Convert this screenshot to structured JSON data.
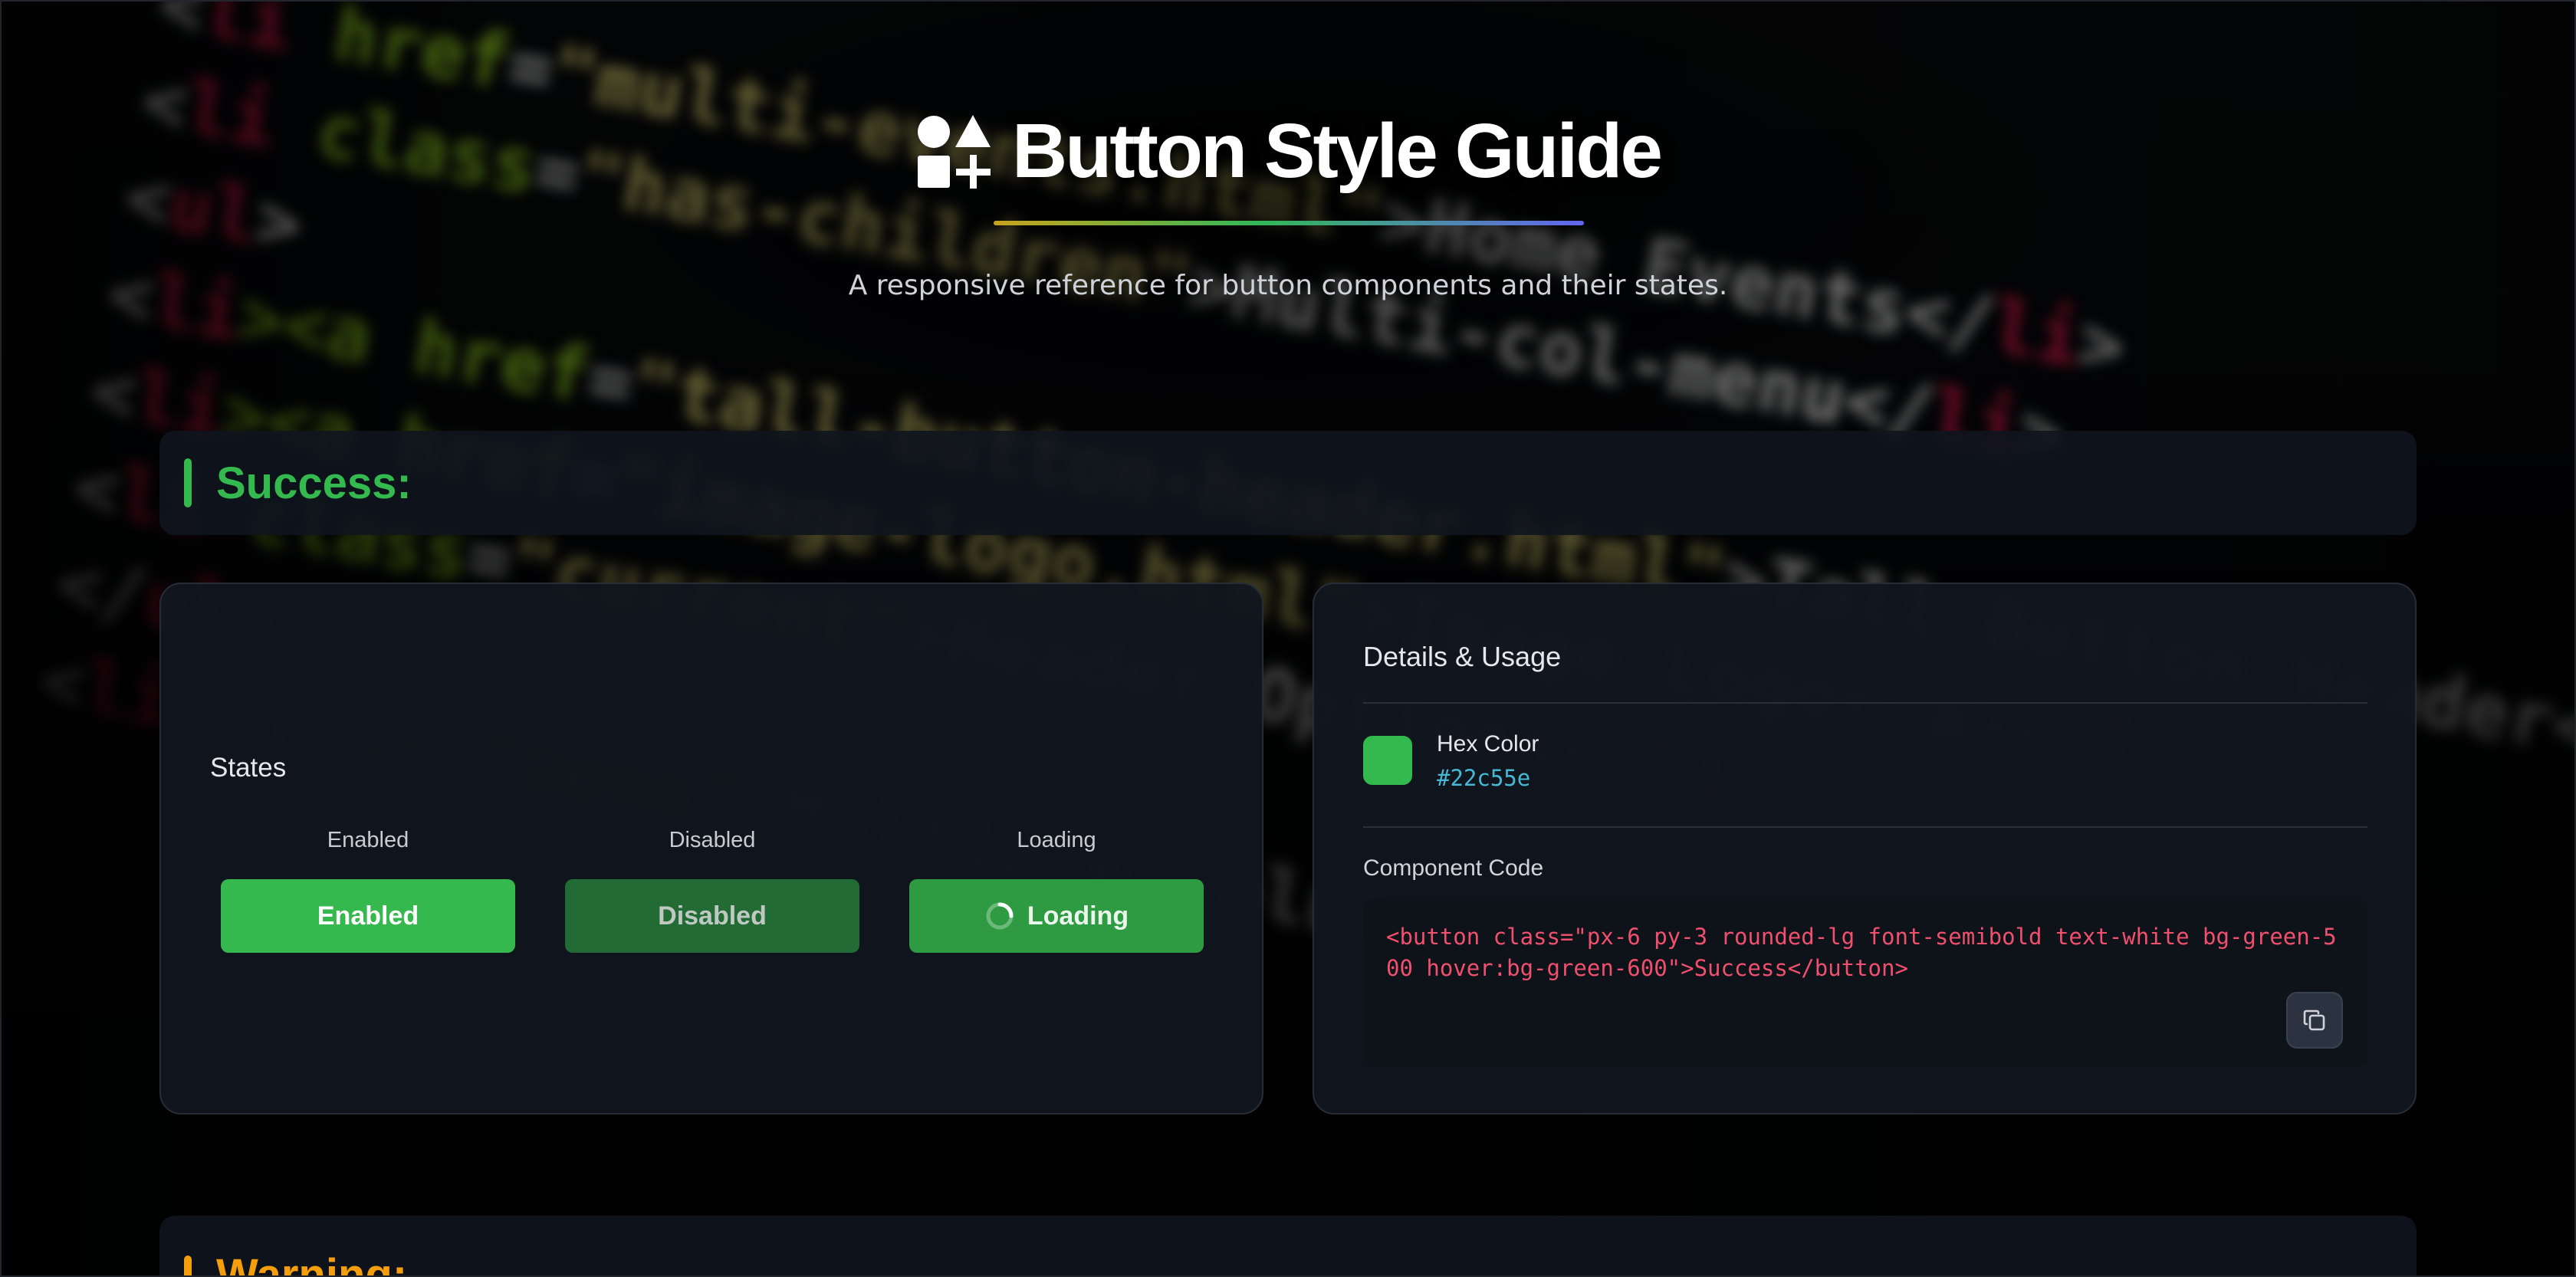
{
  "colors": {
    "success": "#22c55e",
    "success_text": "#33b94e",
    "warning": "#f59e0b"
  },
  "header": {
    "title": "Button Style Guide",
    "subtitle": "A responsive reference for button components and their states.",
    "icon": "shapes-icon"
  },
  "sections": [
    {
      "label": "Success:",
      "states": {
        "heading": "States",
        "items": [
          {
            "caption": "Enabled",
            "button_label": "Enabled"
          },
          {
            "caption": "Disabled",
            "button_label": "Disabled"
          },
          {
            "caption": "Loading",
            "button_label": "Loading",
            "icon": "spinner-icon"
          }
        ]
      },
      "details": {
        "heading": "Details & Usage",
        "hex_label": "Hex Color",
        "hex_value": "#22c55e",
        "code_label": "Component Code",
        "code": "<button class=\"px-6 py-3 rounded-lg font-semibold text-white bg-green-500 hover:bg-green-600\">Success</button>",
        "copy_icon": "copy-icon"
      }
    },
    {
      "label": "Warning:"
    }
  ],
  "backdrop_code": [
    [
      "<",
      "li",
      " href",
      "=",
      "\"multi-events.html\"",
      ">Home Events</",
      "li",
      ">"
    ],
    [
      "<",
      "li",
      " class",
      "=",
      "\"has-children\"",
      ">Multi-col-menu</",
      "li",
      ">"
    ],
    [
      "<",
      "ul",
      "",
      "",
      "",
      ">",
      "",
      ""
    ],
    [
      "<",
      "li",
      "><a href",
      "=",
      "\"tall-button-header.html\"",
      ">Tall Button Header</a></",
      "li",
      ">"
    ],
    [
      "<",
      "li",
      "><a href",
      "=",
      "\"image-logo.html\"",
      ">Image Logo</a></",
      "li",
      ">"
    ],
    [
      "<",
      "li",
      " class",
      "=",
      "\"current\"",
      ">Header Options</",
      "li",
      ">"
    ],
    [
      "</",
      "ul",
      "",
      "",
      "",
      ">",
      "",
      ""
    ],
    [
      "<",
      "li",
      " class",
      "=",
      "\"menu\"",
      ">Multiple Column Menu</",
      "li",
      ">"
    ]
  ]
}
